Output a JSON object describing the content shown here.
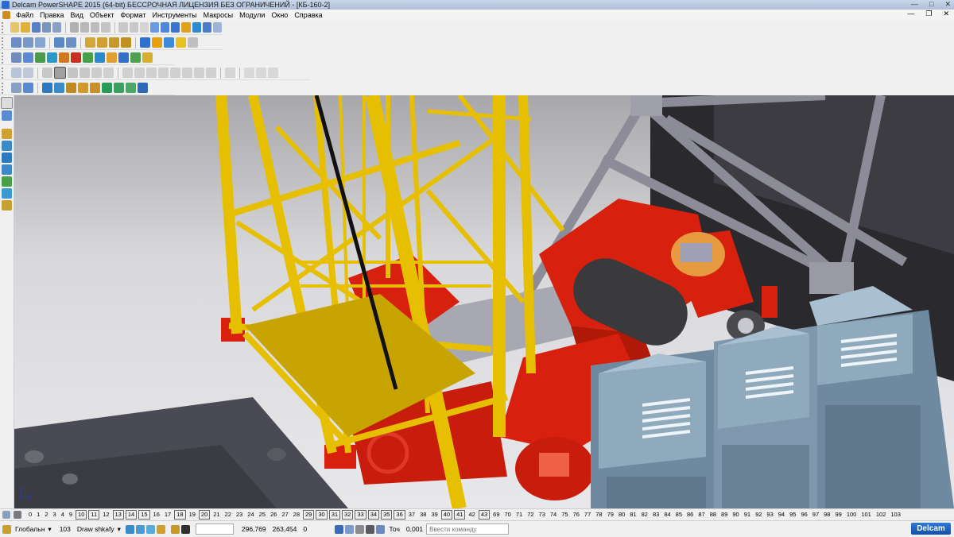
{
  "window": {
    "title": "Delcam PowerSHAPE 2015 (64-bit) БЕССРОЧНАЯ ЛИЦЕНЗИЯ БЕЗ ОГРАНИЧЕНИЙ - [КБ-160-2]"
  },
  "menu": [
    "Файл",
    "Правка",
    "Вид",
    "Объект",
    "Формат",
    "Инструменты",
    "Макросы",
    "Модули",
    "Окно",
    "Справка"
  ],
  "levels": [
    "0",
    "1",
    "2",
    "3",
    "4",
    "9",
    "10",
    "11",
    "12",
    "13",
    "14",
    "15",
    "16",
    "17",
    "18",
    "19",
    "20",
    "21",
    "22",
    "23",
    "24",
    "25",
    "26",
    "27",
    "28",
    "29",
    "30",
    "31",
    "32",
    "33",
    "34",
    "35",
    "36",
    "37",
    "38",
    "39",
    "40",
    "41",
    "42",
    "43",
    "69",
    "70",
    "71",
    "72",
    "73",
    "74",
    "75",
    "76",
    "77",
    "78",
    "79",
    "80",
    "81",
    "82",
    "83",
    "84",
    "85",
    "86",
    "87",
    "88",
    "89",
    "90",
    "91",
    "92",
    "93",
    "94",
    "95",
    "96",
    "97",
    "98",
    "99",
    "100",
    "101",
    "102",
    "103"
  ],
  "levels_boxed": [
    "10",
    "11",
    "13",
    "14",
    "15",
    "18",
    "20",
    "29",
    "30",
    "31",
    "32",
    "33",
    "34",
    "35",
    "36",
    "40",
    "41",
    "43"
  ],
  "status": {
    "workplane": "Глобальн",
    "level_num": "103",
    "level_name": "Draw shkafy",
    "coord_x": "296,769",
    "coord_y": "263,454",
    "coord_z": "0",
    "tolerance_label": "Точ",
    "tolerance_value": "0,001",
    "command_placeholder": "Ввести команду",
    "brand": "Delcam"
  },
  "colors": {
    "crane_yellow": "#e6c000",
    "winch_red": "#d8200e",
    "drum_dark": "#3a3a3c",
    "cabinet_blue": "#8fa9bd",
    "frame_grey": "#8c8c98"
  }
}
